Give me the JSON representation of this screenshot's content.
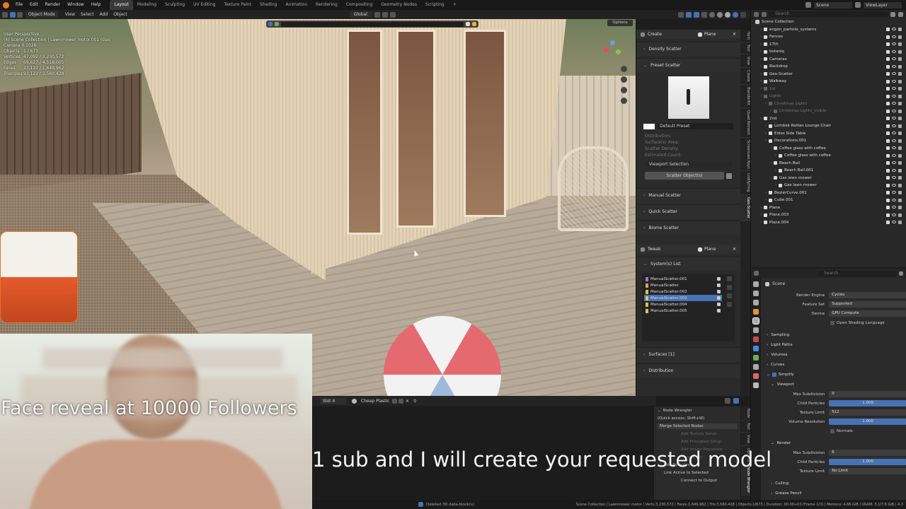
{
  "menu": [
    "File",
    "Edit",
    "Render",
    "Window",
    "Help"
  ],
  "workspaces": [
    "Layout",
    "Modeling",
    "Sculpting",
    "UV Editing",
    "Texture Paint",
    "Shading",
    "Animation",
    "Rendering",
    "Compositing",
    "Geometry Nodes",
    "Scripting"
  ],
  "active_workspace": "Layout",
  "scene": "Scene",
  "view_layer": "ViewLayer",
  "viewport_header": {
    "mode": "Object Mode",
    "menus": [
      "View",
      "Select",
      "Add",
      "Object"
    ],
    "orientation": "Global",
    "options_label": "Options"
  },
  "viewport_overlay": {
    "view_name": "User Perspective",
    "collection_line": "(4) Scene Collection | Lawnmower motor.001 (Gas",
    "camera_line": "Camera 0.1026",
    "stats": [
      {
        "label": "Objects",
        "value": "1 / 673"
      },
      {
        "label": "Vertices",
        "value": "47,092 / 3,230,572"
      },
      {
        "label": "Edges",
        "value": "69,627 / 4,518,005"
      },
      {
        "label": "Faces",
        "value": "23,122 / 1,649,962"
      },
      {
        "label": "Triangles",
        "value": "93,122 / 3,560,428"
      }
    ]
  },
  "npanel": {
    "create_title": "Create",
    "create_object": "Plane",
    "sections_top": [
      "Density Scatter",
      "Preset Scatter"
    ],
    "preset_name": "Default Preset",
    "info_rows": [
      "Distribution:",
      "Surface(s) Area:",
      "Scatter Density:",
      "Estimated Count:"
    ],
    "viewport_selection": "Viewport Selection",
    "scatter_button": "Scatter Object(s)",
    "sections_bottom": [
      "Manual Scatter",
      "Quick Scatter",
      "Biome Scatter"
    ],
    "tweak_title": "Tweak",
    "tweak_object": "Plane",
    "systems_title": "System(s) List",
    "systems": [
      {
        "name": "ManualScatter.001",
        "color": "#b36fd0"
      },
      {
        "name": "ManualScatter",
        "color": "#e0a04a"
      },
      {
        "name": "ManualScatter.002",
        "color": "#d6c35a"
      },
      {
        "name": "ManualScatter.003",
        "color": "#d6c35a"
      },
      {
        "name": "ManualScatter.004",
        "color": "#d6c35a"
      },
      {
        "name": "ManualScatter.005",
        "color": "#d6c35a"
      }
    ],
    "active_system_index": 3,
    "surfaces": "Surfaces [1]",
    "distribution": "Distribution"
  },
  "side_tabs": [
    "Item",
    "Tool",
    "View",
    "Create",
    "BlenderKit",
    "Quad Remesh",
    "Screencast Keys",
    "Lodify/ring",
    "Geo-Scatter"
  ],
  "outliner": {
    "root": "Scene Collection",
    "search_placeholder": "Search",
    "items": [
      {
        "name": "engon_particle_systems",
        "depth": 1,
        "dim": false
      },
      {
        "name": "Fences",
        "depth": 1,
        "dim": false
      },
      {
        "name": "17th",
        "depth": 1,
        "dim": false
      },
      {
        "name": "botaniq",
        "depth": 1,
        "dim": false
      },
      {
        "name": "Cameras",
        "depth": 1,
        "dim": false
      },
      {
        "name": "Backdrop",
        "depth": 1,
        "dim": false
      },
      {
        "name": "Geo-Scatter",
        "depth": 1,
        "dim": false
      },
      {
        "name": "Walkway",
        "depth": 1,
        "dim": false
      },
      {
        "name": "1st",
        "depth": 1,
        "dim": true
      },
      {
        "name": "Lights",
        "depth": 1,
        "dim": true
      },
      {
        "name": "Christmas Lights",
        "depth": 2,
        "dim": true
      },
      {
        "name": "Christmas Lights_visible",
        "depth": 3,
        "dim": true
      },
      {
        "name": "2nd",
        "depth": 1,
        "dim": false
      },
      {
        "name": "Lombok Rattan Lounge Chair",
        "depth": 2,
        "dim": false
      },
      {
        "name": "Eidos Side Table",
        "depth": 2,
        "dim": false
      },
      {
        "name": "Decorations.001",
        "depth": 2,
        "dim": false
      },
      {
        "name": "Coffee glass with coffee",
        "depth": 3,
        "dim": false
      },
      {
        "name": "Coffee glass with coffee",
        "depth": 4,
        "dim": false
      },
      {
        "name": "Beach Ball",
        "depth": 3,
        "dim": false
      },
      {
        "name": "Beach Ball.001",
        "depth": 4,
        "dim": false
      },
      {
        "name": "Gas lawn mower",
        "depth": 3,
        "dim": false
      },
      {
        "name": "Gas lawn mower",
        "depth": 4,
        "dim": false
      },
      {
        "name": "BezierCurve.001",
        "depth": 2,
        "dim": false
      },
      {
        "name": "Cube.001",
        "depth": 2,
        "dim": false
      },
      {
        "name": "Plane",
        "depth": 1,
        "dim": false
      },
      {
        "name": "Plane.003",
        "depth": 1,
        "dim": false
      },
      {
        "name": "Plane.004",
        "depth": 1,
        "dim": false
      }
    ]
  },
  "properties": {
    "search_placeholder": "Search",
    "breadcrumb": "Scene",
    "render_engine_label": "Render Engine",
    "render_engine": "Cycles",
    "feature_set_label": "Feature Set",
    "feature_set": "Supported",
    "device_label": "Device",
    "device": "GPU Compute",
    "osl_label": "Open Shading Language",
    "collapsed": [
      "Sampling",
      "Light Paths",
      "Volumes",
      "Curves"
    ],
    "simplify": "Simplify",
    "viewport": "Viewport",
    "vp_rows": [
      {
        "label": "Max Subdivision",
        "value": "0",
        "blue": false
      },
      {
        "label": "Child Particles",
        "value": "1.000",
        "blue": true
      },
      {
        "label": "Texture Limit",
        "value": "512",
        "blue": false
      },
      {
        "label": "Volume Resolution",
        "value": "1.000",
        "blue": true
      }
    ],
    "normals": "Normals",
    "render": "Render",
    "render_rows": [
      {
        "label": "Max Subdivision",
        "value": "6",
        "blue": false
      },
      {
        "label": "Child Particles",
        "value": "1.000",
        "blue": true
      },
      {
        "label": "Texture Limit",
        "value": "No Limit",
        "blue": false
      }
    ],
    "culling": "Culling",
    "grease_pencil": "Grease Pencil"
  },
  "node_editor": {
    "slot": "Slot 4",
    "material": "Cheap Plastic",
    "nw_title": "Node Wrangler",
    "nw_quick": "(Quick access: Shift+W)",
    "nw_merge": "Merge Selected Nodes",
    "nw_items": [
      "Add Texture Setup",
      "Add Principled Setup",
      "Add Image Sequence",
      "Swap Links",
      "Add Reroutes",
      "Link Active to Selected",
      "Connect to Output"
    ],
    "nw_tabs": [
      "Node",
      "Tool",
      "View",
      "Options",
      "Node Wrangler"
    ]
  },
  "status_bar": {
    "message": "Deleted 30 data-block(s)",
    "stats": "Scene Collection | Lawnmower motor | Verts:3,230,572 | Faces:1,649,962 | Tris:3,560,428 | Objects:1/673 | Duration: 00:00+03 (Frame 1/3) | Memory: 4.66 GiB | VRAM: 3.1/7.8 GiB | 4.3"
  },
  "captions": {
    "face_reveal": "Face reveal at 10000 Followers",
    "sub_request": "1 sub and I will create your requested model"
  },
  "colors": {
    "accent": "#4772b3",
    "panel": "#2b2b2b",
    "header": "#222222"
  }
}
